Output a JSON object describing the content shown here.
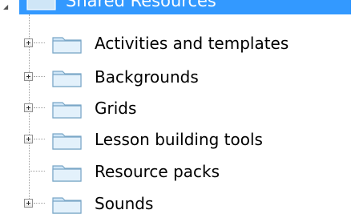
{
  "tree": {
    "root": {
      "label": "Shared Resources",
      "selected": true,
      "icon": "folder-icon"
    },
    "items": [
      {
        "label": "Activities and templates",
        "has_children": true,
        "icon": "folder-icon"
      },
      {
        "label": "Backgrounds",
        "has_children": true,
        "icon": "folder-icon"
      },
      {
        "label": "Grids",
        "has_children": true,
        "icon": "folder-icon"
      },
      {
        "label": "Lesson building tools",
        "has_children": true,
        "icon": "folder-icon"
      },
      {
        "label": "Resource packs",
        "has_children": false,
        "icon": "folder-icon"
      },
      {
        "label": "Sounds",
        "has_children": true,
        "icon": "folder-icon"
      }
    ]
  },
  "colors": {
    "selection": "#3399ff",
    "folder_fill": "#cfe6f7",
    "folder_stroke": "#7aa7c7"
  }
}
